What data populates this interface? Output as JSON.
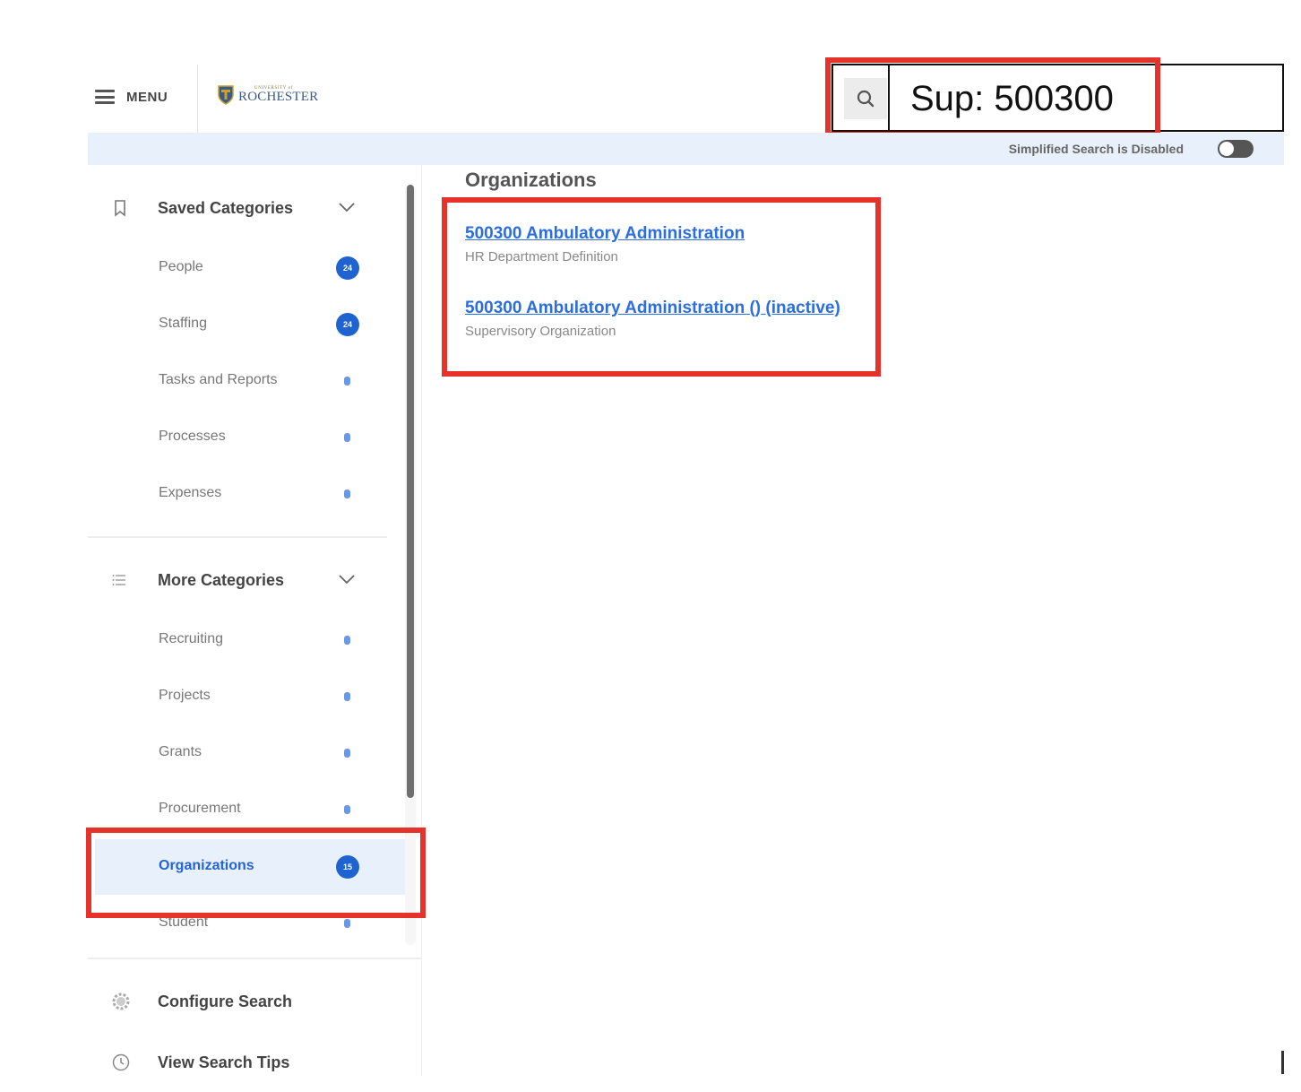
{
  "header": {
    "menu_label": "MENU",
    "logo_small": "UNIVERSITY of",
    "logo_big": "ROCHESTER"
  },
  "search": {
    "value": "Sup: 500300",
    "icon": "search-icon"
  },
  "simplified_search": {
    "label": "Simplified Search is Disabled",
    "enabled": false
  },
  "sidebar": {
    "saved": {
      "title": "Saved Categories",
      "icon": "bookmark-icon",
      "items": [
        {
          "label": "People",
          "badge": "24"
        },
        {
          "label": "Staffing",
          "badge": "24"
        },
        {
          "label": "Tasks and Reports",
          "badge": "0"
        },
        {
          "label": "Processes",
          "badge": "0"
        },
        {
          "label": "Expenses",
          "badge": "0"
        }
      ]
    },
    "more": {
      "title": "More Categories",
      "icon": "list-icon",
      "items": [
        {
          "label": "Recruiting",
          "badge": "0"
        },
        {
          "label": "Projects",
          "badge": "0"
        },
        {
          "label": "Grants",
          "badge": "0"
        },
        {
          "label": "Procurement",
          "badge": "0"
        },
        {
          "label": "Organizations",
          "badge": "15",
          "selected": true
        },
        {
          "label": "Student",
          "badge": "0"
        }
      ]
    },
    "configure_search": "Configure Search",
    "view_search_tips": "View Search Tips"
  },
  "main": {
    "title": "Organizations",
    "results": [
      {
        "title": "500300 Ambulatory Administration",
        "subtitle": "HR Department Definition"
      },
      {
        "title": "500300 Ambulatory Administration () (inactive)",
        "subtitle": "Supervisory Organization"
      }
    ]
  },
  "colors": {
    "accent": "#1f63d1",
    "link": "#2c6de0",
    "highlight": "#e5322b",
    "selected_bg": "#e8f0fb"
  }
}
